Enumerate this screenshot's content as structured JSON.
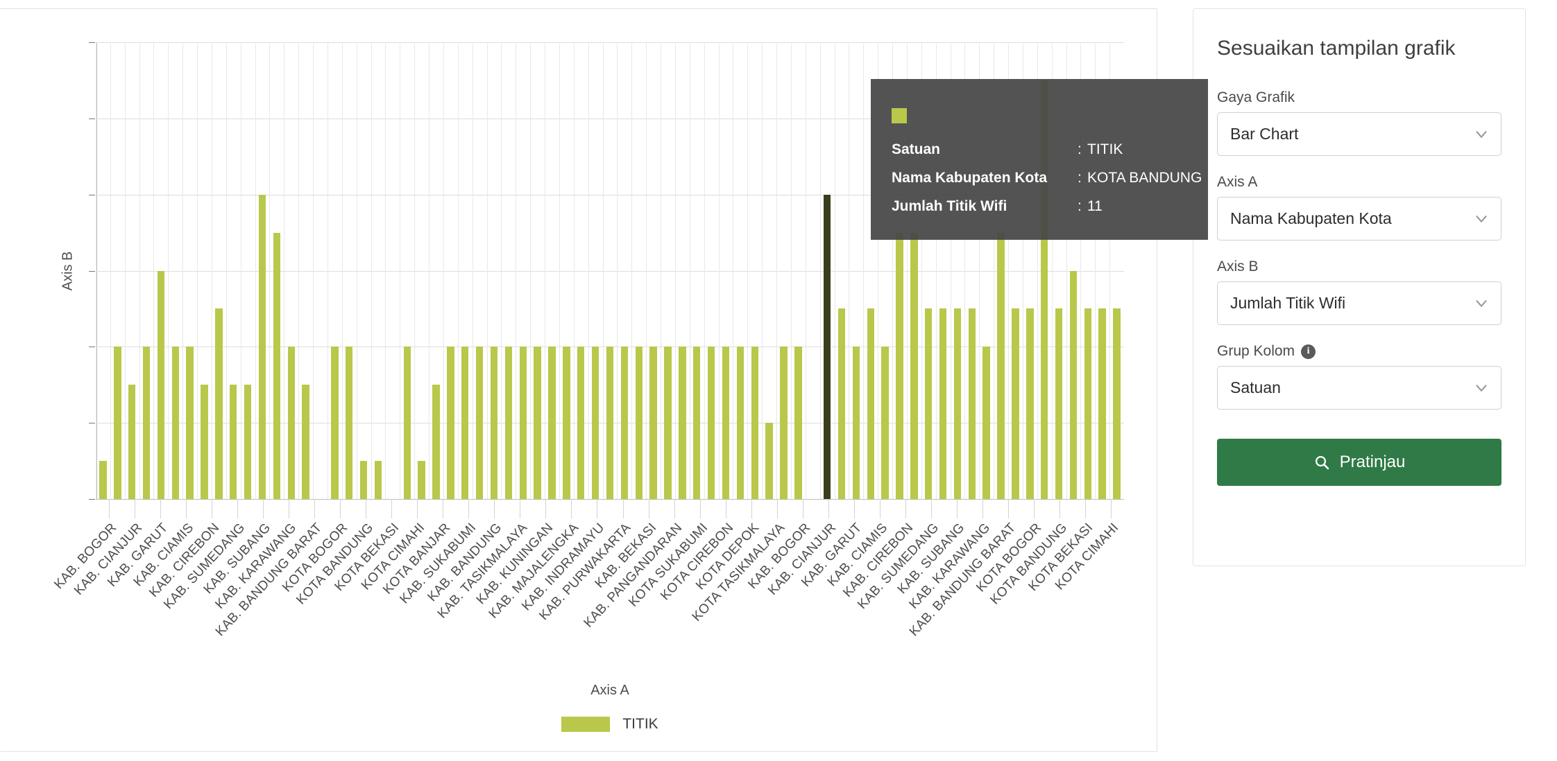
{
  "chart_data": {
    "type": "bar",
    "title": "",
    "xlabel": "Axis A",
    "ylabel": "Axis B",
    "ylim": [
      0,
      12
    ],
    "yticks": [
      0,
      2,
      4,
      6,
      8,
      10,
      12
    ],
    "grid": true,
    "legend_position": "bottom",
    "series_name": "TITIK",
    "bar_color": "#b9c84a",
    "highlight_color": "#3a3d1b",
    "highlight_index": 50,
    "categories": [
      "KAB. BOGOR",
      "KAB. CIANJUR",
      "KAB. GARUT",
      "KAB. CIAMIS",
      "KAB. CIREBON",
      "KAB. SUMEDANG",
      "KAB. SUBANG",
      "KAB. KARAWANG",
      "KAB. BANDUNG BARAT",
      "KOTA BOGOR",
      "KOTA BANDUNG",
      "KOTA BEKASI",
      "KOTA CIMAHI",
      "KOTA BANJAR",
      "KAB. SUKABUMI",
      "KAB. BANDUNG",
      "KAB. TASIKMALAYA",
      "KAB. KUNINGAN",
      "KAB. MAJALENGKA",
      "KAB. INDRAMAYU",
      "KAB. PURWAKARTA",
      "KAB. BEKASI",
      "KAB. PANGANDARAN",
      "KOTA SUKABUMI",
      "KOTA CIREBON",
      "KOTA DEPOK",
      "KOTA TASIKMALAYA",
      "KAB. BOGOR",
      "KAB. CIANJUR",
      "KAB. GARUT",
      "KAB. CIAMIS",
      "KAB. CIREBON",
      "KAB. SUMEDANG",
      "KAB. SUBANG",
      "KAB. KARAWANG",
      "KAB. BANDUNG BARAT",
      "KOTA BOGOR",
      "KOTA BANDUNG",
      "KOTA BEKASI",
      "KOTA CIMAHI"
    ],
    "values": [
      1,
      4,
      3,
      4,
      6,
      4,
      4,
      3,
      5,
      3,
      3,
      8,
      7,
      4,
      3,
      0,
      4,
      4,
      1,
      1,
      0,
      4,
      1,
      3,
      4,
      4,
      4,
      4,
      4,
      4,
      4,
      4,
      4,
      4,
      4,
      4,
      4,
      4,
      4,
      4,
      4,
      4,
      4,
      4,
      4,
      4,
      2,
      4,
      4,
      0,
      8,
      5,
      4,
      5,
      4,
      7,
      7,
      5,
      5,
      5,
      5,
      4,
      7,
      5,
      5,
      11,
      5,
      6,
      5,
      5,
      5
    ]
  },
  "tooltip": {
    "rows": [
      {
        "key": "Satuan",
        "sep": ":",
        "value": "TITIK"
      },
      {
        "key": "Nama Kabupaten Kota",
        "sep": ":",
        "value": "KOTA BANDUNG"
      },
      {
        "key": "Jumlah Titik Wifi",
        "sep": ":",
        "value": "11"
      }
    ]
  },
  "panel": {
    "title": "Sesuaikan tampilan grafik",
    "fields": [
      {
        "label": "Gaya Grafik",
        "value": "Bar Chart",
        "has_info": false
      },
      {
        "label": "Axis A",
        "value": "Nama Kabupaten Kota",
        "has_info": false
      },
      {
        "label": "Axis B",
        "value": "Jumlah Titik Wifi",
        "has_info": false
      },
      {
        "label": "Grup Kolom",
        "value": "Satuan",
        "has_info": true,
        "info_glyph": "i"
      }
    ],
    "preview_button": "Pratinjau",
    "accent_color": "#2f7a46"
  }
}
